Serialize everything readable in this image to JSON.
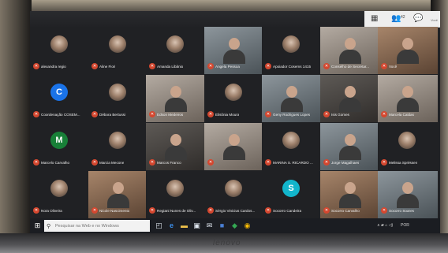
{
  "meet_toolbar": {
    "icons": [
      "grid-view-icon",
      "people-icon",
      "chat-icon"
    ],
    "people_count": "42",
    "self_label": "Você"
  },
  "participants": [
    {
      "name": "alexandra regio",
      "tile": "avatar-photo"
    },
    {
      "name": "Aline Fiori",
      "tile": "avatar-photo"
    },
    {
      "name": "Amanda Libânio",
      "tile": "avatar-photo"
    },
    {
      "name": "Angela Pessoa",
      "tile": "video"
    },
    {
      "name": "Apoiador Cosems 1415",
      "tile": "avatar-photo"
    },
    {
      "name": "Conselho de Secretar...",
      "tile": "video"
    },
    {
      "name": "Você",
      "tile": "video"
    },
    {
      "name": "Coordenação COSEM...",
      "tile": "avatar-letter",
      "letter": "C",
      "color": "#1a73e8"
    },
    {
      "name": "Débora Bertussi",
      "tile": "avatar-photo"
    },
    {
      "name": "Edson Medeiros",
      "tile": "video"
    },
    {
      "name": "Elisônia Moura",
      "tile": "avatar-photo"
    },
    {
      "name": "Geny Rodrigues Lopes",
      "tile": "video"
    },
    {
      "name": "Isis Gomes",
      "tile": "video"
    },
    {
      "name": "Marcela Caldas",
      "tile": "video"
    },
    {
      "name": "Marcelo Carvalho",
      "tile": "avatar-letter",
      "letter": "M",
      "color": "#188038"
    },
    {
      "name": "Marcia Mecone",
      "tile": "avatar-photo"
    },
    {
      "name": "Marcos Franco",
      "tile": "video"
    },
    {
      "name": "",
      "tile": "video"
    },
    {
      "name": "MARINA S. RICARDO ...",
      "tile": "avatar-photo"
    },
    {
      "name": "Jorge Magalhaes",
      "tile": "video"
    },
    {
      "name": "Melissa Spréssen",
      "tile": "avatar-photo"
    },
    {
      "name": "Nora Oliveira",
      "tile": "avatar-photo"
    },
    {
      "name": "Nicole Nascimento",
      "tile": "video"
    },
    {
      "name": "Regiani Nunes de Oliv...",
      "tile": "avatar-photo"
    },
    {
      "name": "Sérgio Vinicius Cardos...",
      "tile": "avatar-photo"
    },
    {
      "name": "Socorro Candeira",
      "tile": "avatar-letter",
      "letter": "S",
      "color": "#12b5cb"
    },
    {
      "name": "Socorro Carvalho",
      "tile": "video"
    },
    {
      "name": "Socorro Soares",
      "tile": "video"
    }
  ],
  "taskbar": {
    "search_placeholder": "Pesquisar na Web e no Windows",
    "pinned_icons": [
      "task-view-icon",
      "edge-icon",
      "file-explorer-icon",
      "store-icon",
      "mail-icon",
      "word-icon",
      "maps-icon",
      "chrome-icon"
    ],
    "tray_text": "∧ ▰ ⌂ ◁)",
    "language": "POR",
    "time": "",
    "date": ""
  }
}
